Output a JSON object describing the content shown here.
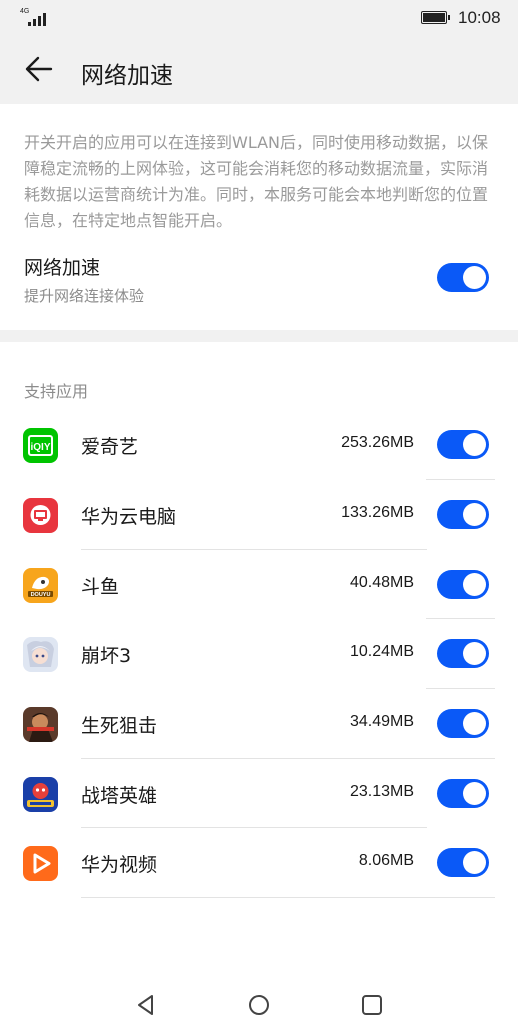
{
  "status_bar": {
    "network": "4G",
    "time": "10:08"
  },
  "header": {
    "title": "网络加速"
  },
  "description": "开关开启的应用可以在连接到WLAN后，同时使用移动数据，以保障稳定流畅的上网体验，这可能会消耗您的移动数据流量，实际消耗数据以运营商统计为准。同时，本服务可能会本地判断您的位置信息，在特定地点智能开启。",
  "main_toggle": {
    "title": "网络加速",
    "subtitle": "提升网络连接体验",
    "enabled": true
  },
  "apps_section": {
    "label": "支持应用",
    "apps": [
      {
        "name": "爱奇艺",
        "size": "253.26MB",
        "enabled": true,
        "icon": "iqiyi-icon"
      },
      {
        "name": "华为云电脑",
        "size": "133.26MB",
        "enabled": true,
        "icon": "huawei-cloud-pc-icon"
      },
      {
        "name": "斗鱼",
        "size": "40.48MB",
        "enabled": true,
        "icon": "douyu-icon"
      },
      {
        "name": "崩坏3",
        "size": "10.24MB",
        "enabled": true,
        "icon": "honkai3-icon"
      },
      {
        "name": "生死狙击",
        "size": "34.49MB",
        "enabled": true,
        "icon": "shengsijuji-icon"
      },
      {
        "name": "战塔英雄",
        "size": "23.13MB",
        "enabled": true,
        "icon": "zhantayingxiong-icon"
      },
      {
        "name": "华为视频",
        "size": "8.06MB",
        "enabled": true,
        "icon": "huawei-video-icon"
      }
    ]
  },
  "colors": {
    "accent": "#0a59f7",
    "header_bg": "#f1f1f1"
  }
}
